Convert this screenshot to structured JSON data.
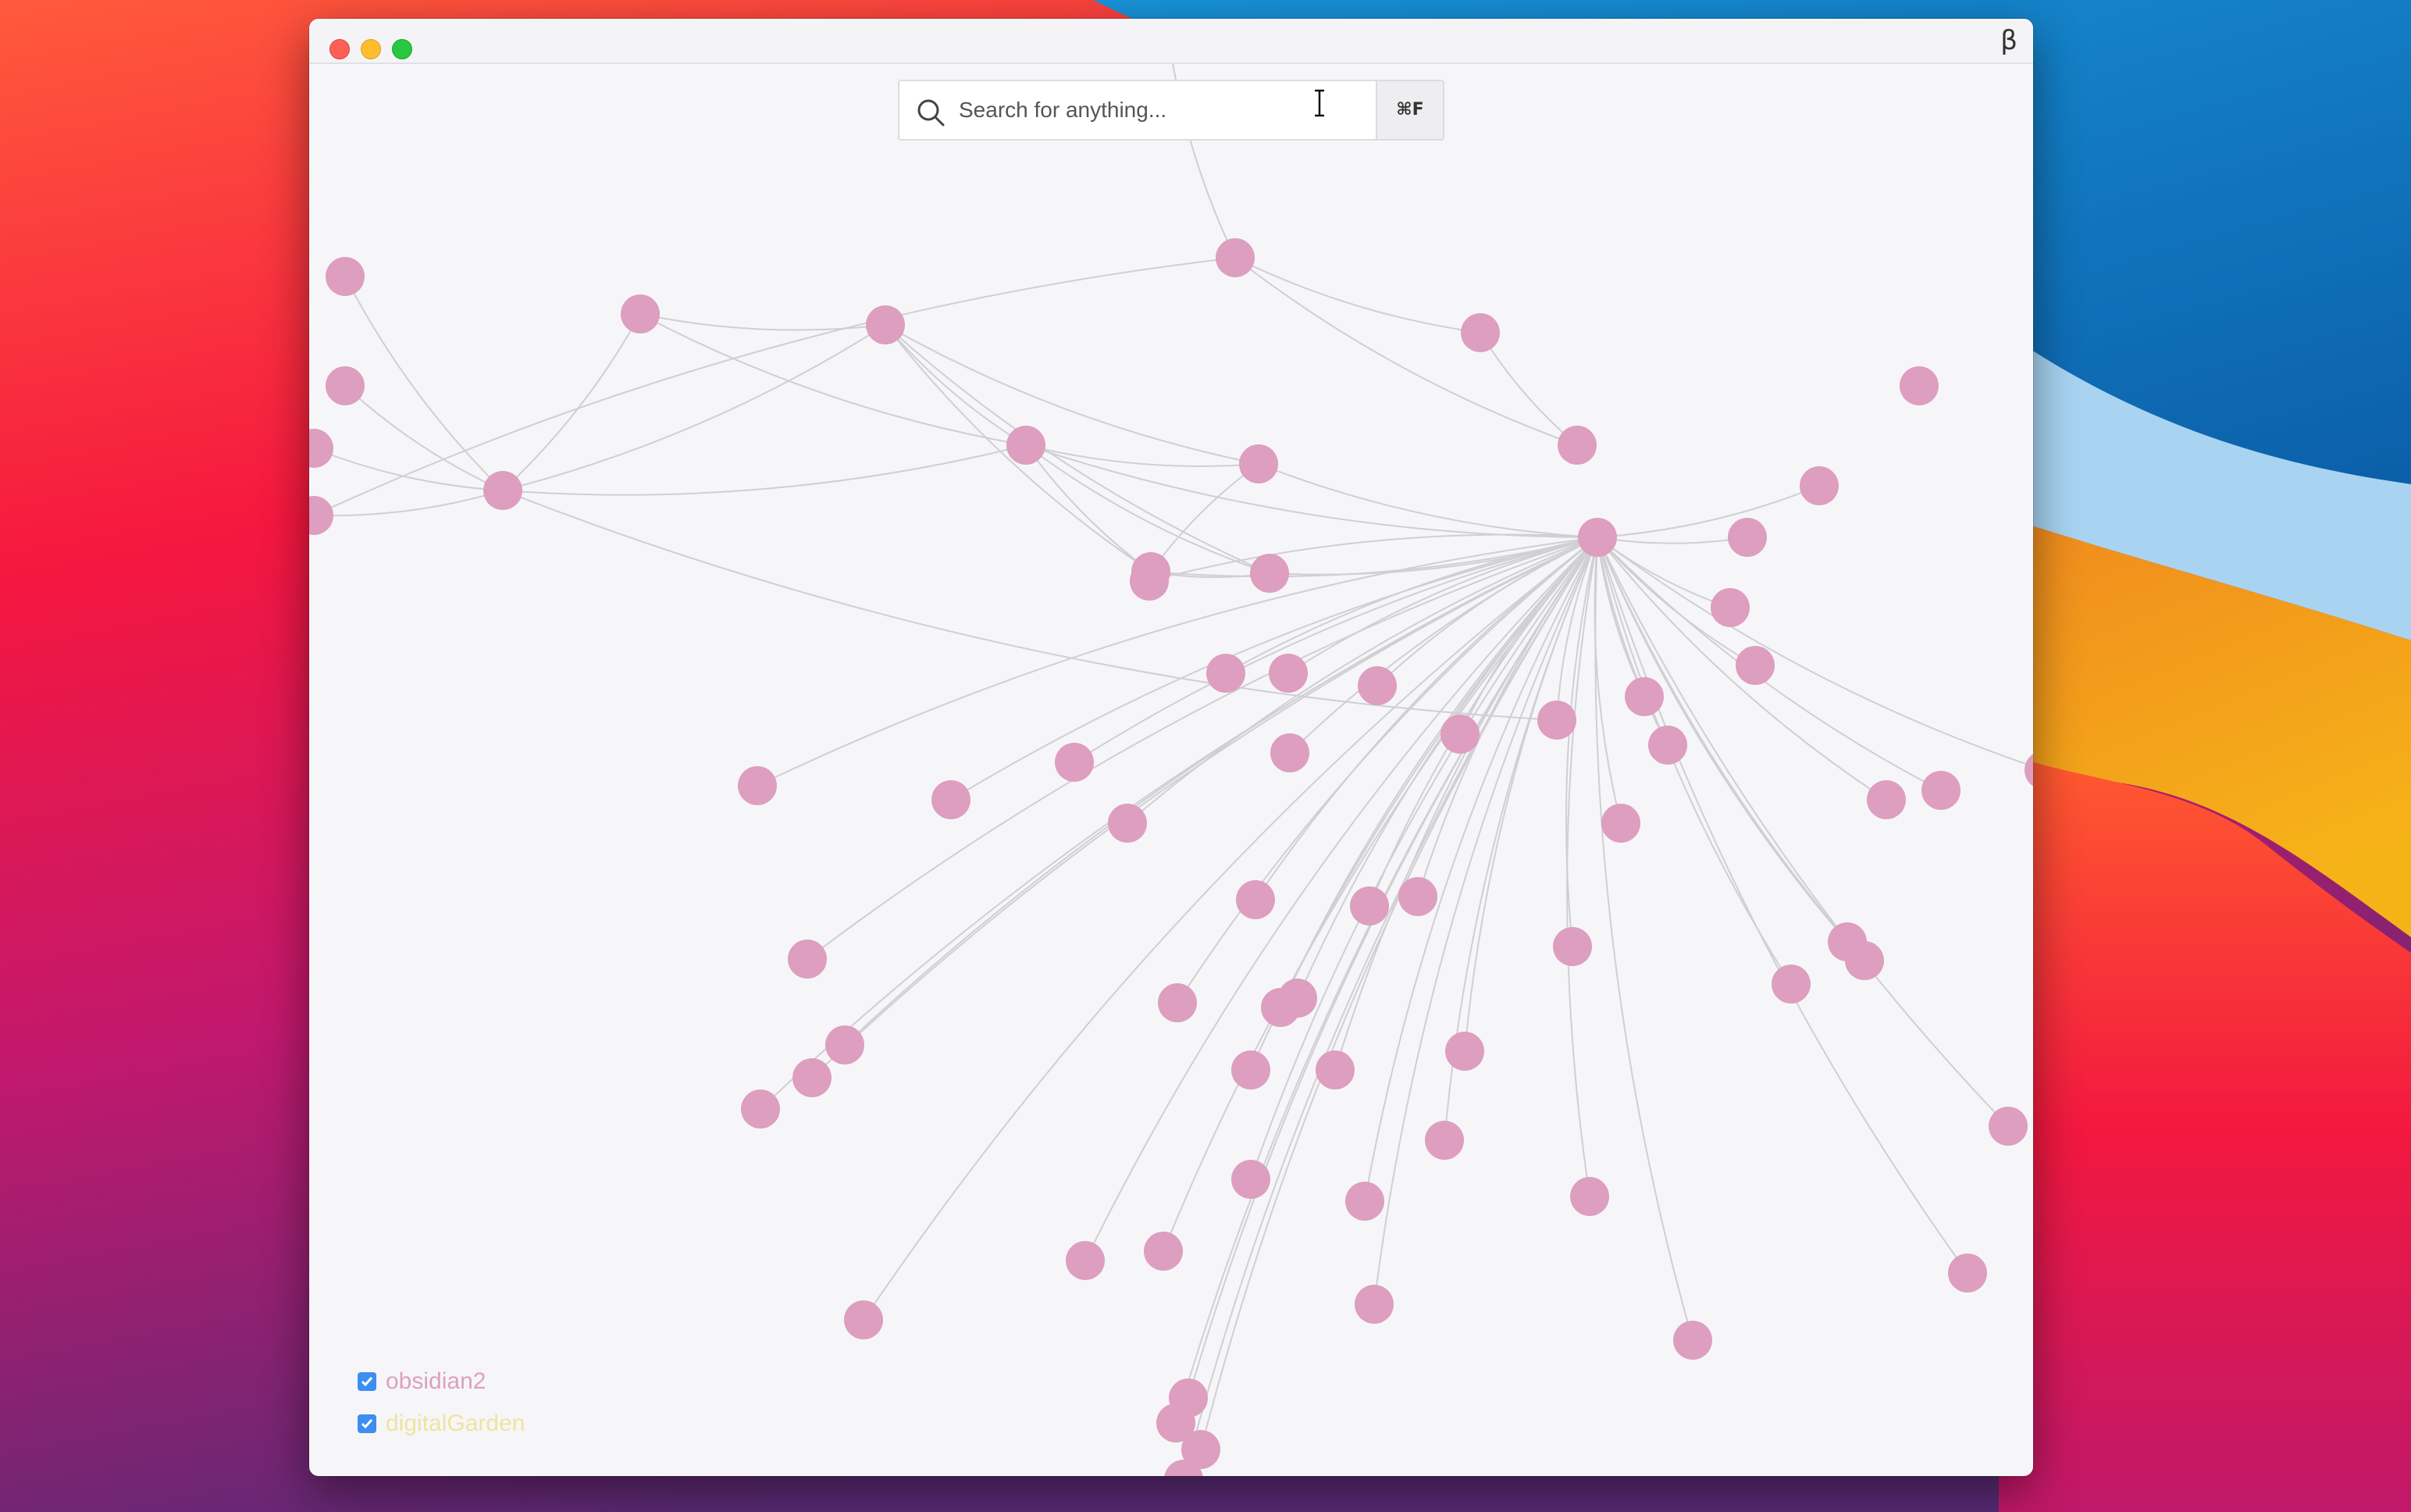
{
  "window": {
    "beta_label": "β"
  },
  "search": {
    "placeholder": "Search for anything...",
    "shortcut": "⌘F"
  },
  "legend": {
    "items": [
      {
        "label": "obsidian2",
        "checked": true,
        "color": "#dda0c1"
      },
      {
        "label": "digitalGarden",
        "checked": true,
        "color": "#f2e2a0"
      }
    ]
  },
  "graph": {
    "node_color": "#dd9ebf",
    "edge_color": "#cfcfd4"
  }
}
